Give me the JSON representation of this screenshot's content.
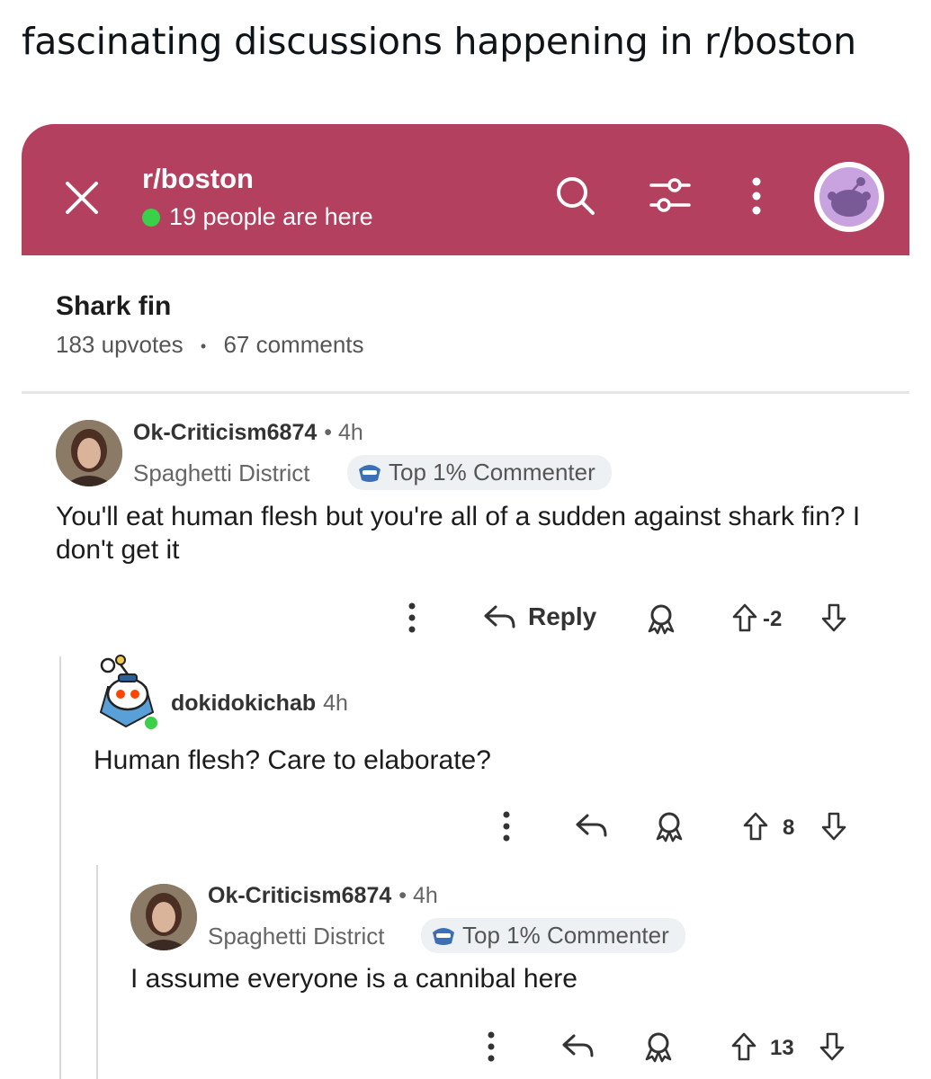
{
  "caption": "fascinating discussions happening in r/boston",
  "colors": {
    "accent": "#b3405f",
    "online": "#3ad04a"
  },
  "header": {
    "subreddit": "r/boston",
    "online_text": "19 people are here",
    "icons": [
      "close-icon",
      "search-icon",
      "filter-icon",
      "more-vertical-icon",
      "avatar-icon"
    ]
  },
  "post": {
    "title": "Shark fin",
    "upvotes": "183 upvotes",
    "separator": "•",
    "comments": "67 comments"
  },
  "comments": [
    {
      "username": "Ok-Criticism6874",
      "time": "• 4h",
      "flair": "Spaghetti District",
      "badge": "Top 1% Commenter",
      "text": "You'll eat human flesh but you're all of a sudden against shark fin? I don't get it",
      "reply_label": "Reply",
      "score": "-2"
    },
    {
      "username": "dokidokichab",
      "time": "4h",
      "text": "Human flesh? Care to elaborate?",
      "score": "8"
    },
    {
      "username": "Ok-Criticism6874",
      "time": "• 4h",
      "flair": "Spaghetti District",
      "badge": "Top 1% Commenter",
      "text": "I assume everyone is a cannibal here",
      "score": "13"
    }
  ]
}
